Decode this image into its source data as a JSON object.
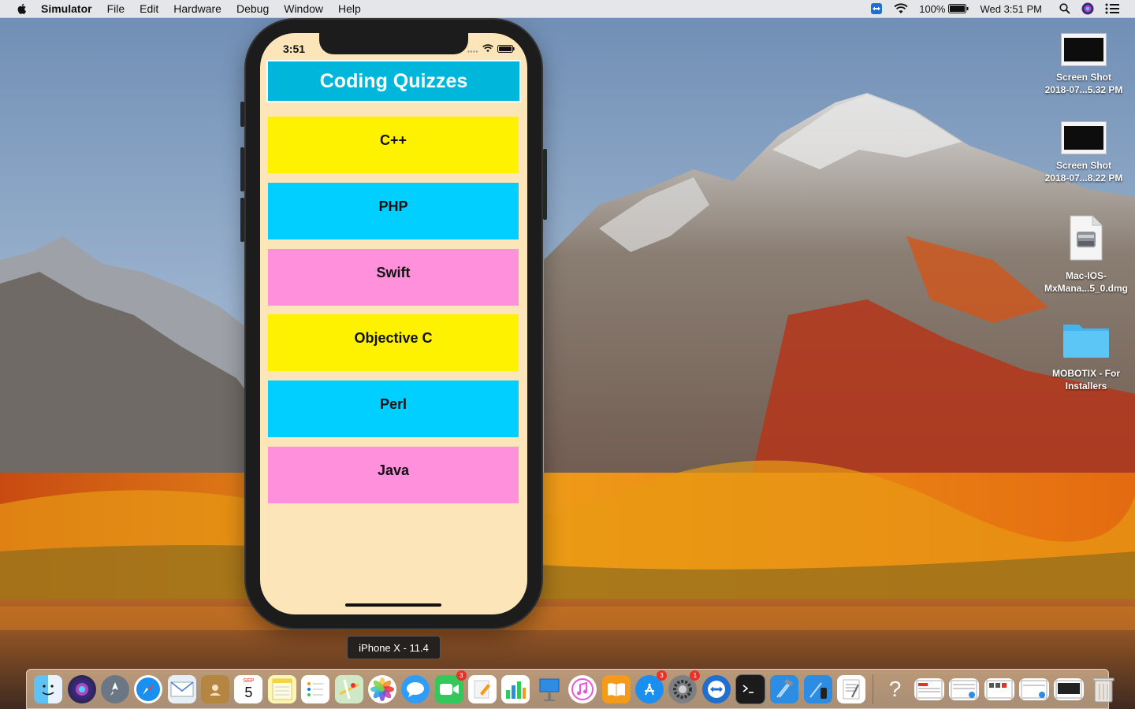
{
  "menubar": {
    "app_name": "Simulator",
    "items": [
      "File",
      "Edit",
      "Hardware",
      "Debug",
      "Window",
      "Help"
    ],
    "battery": "100%",
    "clock": "Wed 3:51 PM"
  },
  "desktop_icons": [
    {
      "line1": "Screen Shot",
      "line2": "2018-07...5.32 PM",
      "icon": "screenshot-icon"
    },
    {
      "line1": "Screen Shot",
      "line2": "2018-07...8.22 PM",
      "icon": "screenshot-icon"
    },
    {
      "line1": "Mac-IOS-",
      "line2": "MxMana...5_0.dmg",
      "icon": "disk-image-icon"
    },
    {
      "line1": "MOBOTIX - For",
      "line2": "Installers",
      "icon": "folder-icon"
    }
  ],
  "phone": {
    "status_time": "3:51",
    "title": "Coding Quizzes",
    "quizzes": [
      {
        "label": "C++",
        "color": "#fff200"
      },
      {
        "label": "PHP",
        "color": "#00cfff"
      },
      {
        "label": "Swift",
        "color": "#ff90dc"
      },
      {
        "label": "Objective C",
        "color": "#fff200"
      },
      {
        "label": "Perl",
        "color": "#00cfff"
      },
      {
        "label": "Java",
        "color": "#ff90dc"
      }
    ],
    "background": "#fbe5b9",
    "title_color": "#00b7db"
  },
  "device_label": "iPhone X - 11.4",
  "dock": {
    "badges": {
      "calendar_date": "5",
      "calendar_month": "SEP",
      "facetime": "3",
      "appstore": "3",
      "sysprefs": "1"
    }
  }
}
